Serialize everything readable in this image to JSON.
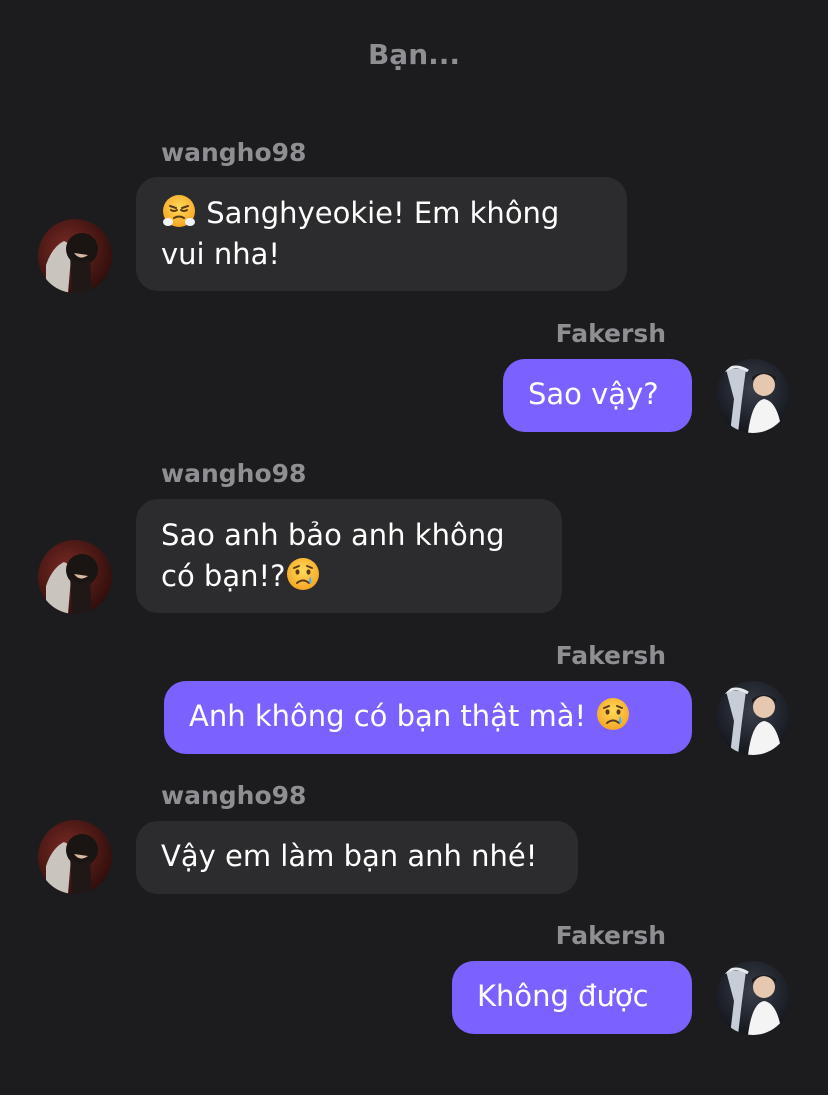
{
  "chat": {
    "title": "Bạn..."
  },
  "users": {
    "friend": "wangho98",
    "me": "Fakersh"
  },
  "messages": [
    {
      "sender": "wangho98",
      "emoji": "face-with-steam-from-nose-emoji",
      "text": "Sanghyeokie! Em không vui nha!"
    },
    {
      "sender": "Fakersh",
      "text": "Sao vậy?"
    },
    {
      "sender": "wangho98",
      "text": "Sao anh bảo anh không có bạn!?",
      "emoji": "crying-face-emoji"
    },
    {
      "sender": "Fakersh",
      "text": "Anh không có bạn thật mà!",
      "emoji": "crying-face-emoji"
    },
    {
      "sender": "wangho98",
      "text": "Vậy em làm bạn anh nhé!"
    },
    {
      "sender": "Fakersh",
      "text": "Không được"
    }
  ],
  "colors": {
    "background": "#1c1c1e",
    "incoming_bubble": "#2c2c2e",
    "outgoing_bubble": "#7b61ff",
    "sender_label": "#8e8e93"
  }
}
